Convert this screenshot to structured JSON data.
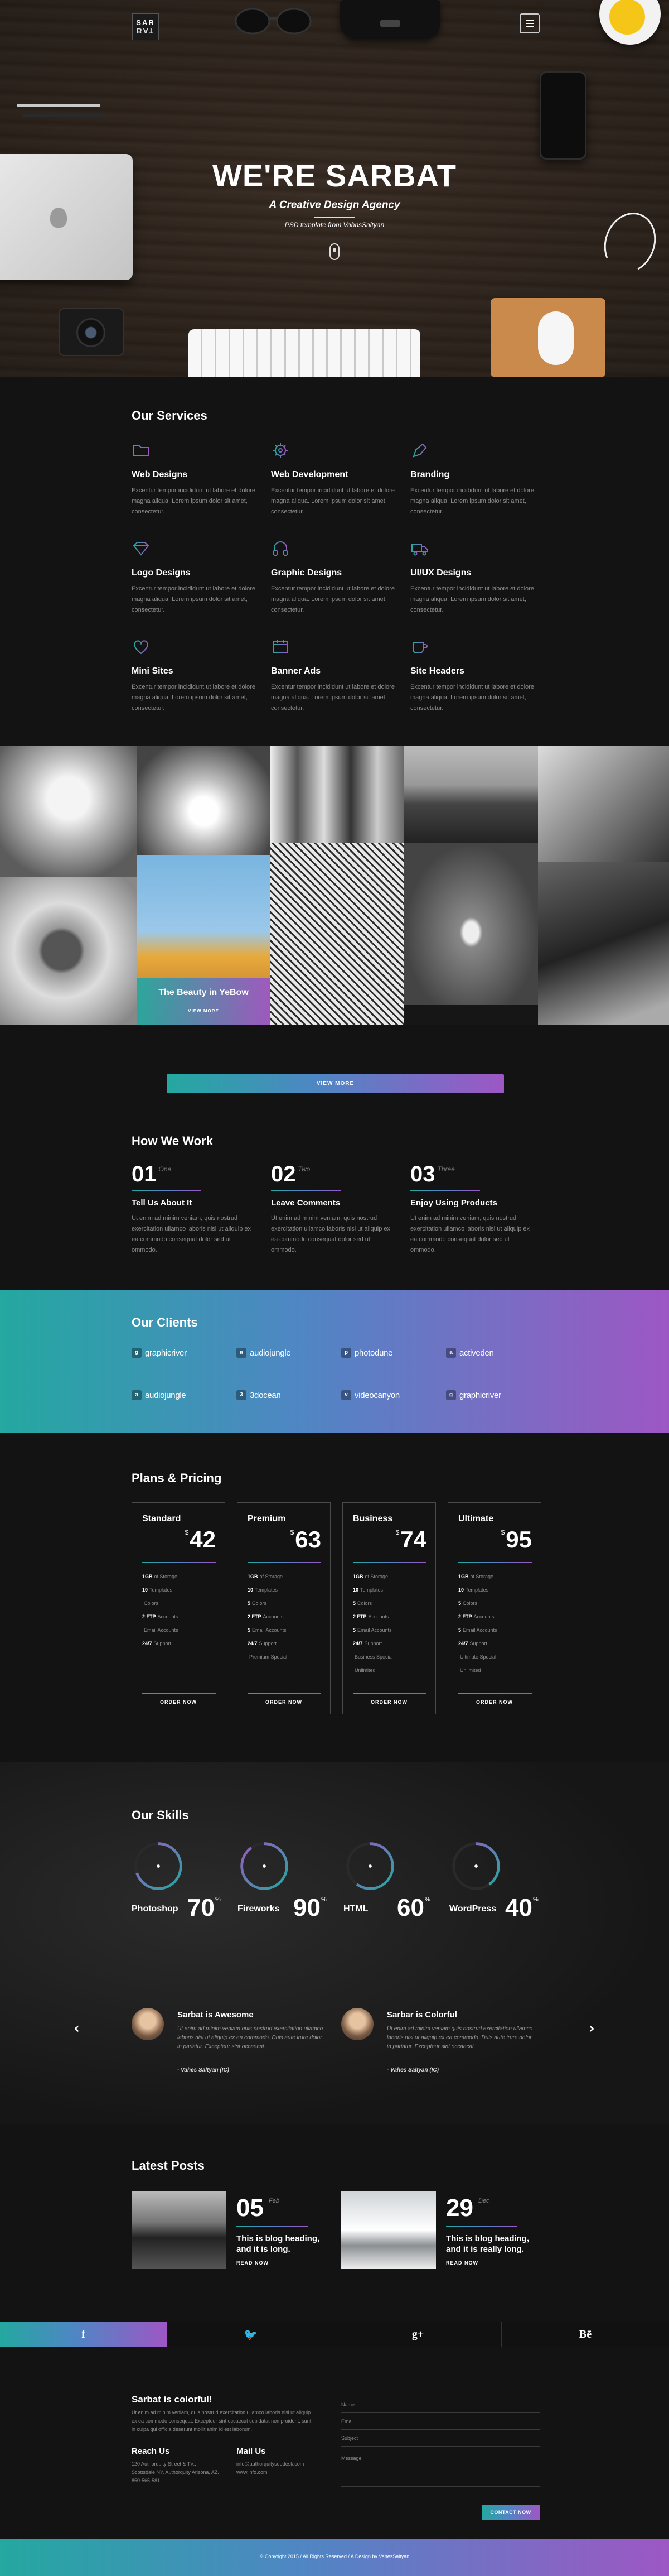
{
  "brand": {
    "logo_top": "SAR",
    "logo_bottom": "BAT"
  },
  "hero": {
    "title": "WE'RE SARBAT",
    "subtitle": "A Creative Design Agency",
    "credit": "PSD template from VahnsSaltyan"
  },
  "services": {
    "title": "Our Services",
    "items": [
      {
        "name": "Web Designs",
        "icon": "folder-icon",
        "desc": "Excentur tempor incididunt ut labore et dolore magna aliqua. Lorem ipsum dolor sit amet, consectetur."
      },
      {
        "name": "Web Development",
        "icon": "gear-icon",
        "desc": "Excentur tempor incididunt ut labore et dolore magna aliqua. Lorem ipsum dolor sit amet, consectetur."
      },
      {
        "name": "Branding",
        "icon": "pen-icon",
        "desc": "Excentur tempor incididunt ut labore et dolore magna aliqua. Lorem ipsum dolor sit amet, consectetur."
      },
      {
        "name": "Logo Designs",
        "icon": "diamond-icon",
        "desc": "Excentur tempor incididunt ut labore et dolore magna aliqua. Lorem ipsum dolor sit amet, consectetur."
      },
      {
        "name": "Graphic Designs",
        "icon": "headphones-icon",
        "desc": "Excentur tempor incididunt ut labore et dolore magna aliqua. Lorem ipsum dolor sit amet, consectetur."
      },
      {
        "name": "UI/UX Designs",
        "icon": "truck-icon",
        "desc": "Excentur tempor incididunt ut labore et dolore magna aliqua. Lorem ipsum dolor sit amet, consectetur."
      },
      {
        "name": "Mini Sites",
        "icon": "heart-icon",
        "desc": "Excentur tempor incididunt ut labore et dolore magna aliqua. Lorem ipsum dolor sit amet, consectetur."
      },
      {
        "name": "Banner Ads",
        "icon": "calendar-icon",
        "desc": "Excentur tempor incididunt ut labore et dolore magna aliqua. Lorem ipsum dolor sit amet, consectetur."
      },
      {
        "name": "Site Headers",
        "icon": "cup-icon",
        "desc": "Excentur tempor incididunt ut labore et dolore magna aliqua. Lorem ipsum dolor sit amet, consectetur."
      }
    ]
  },
  "gallery": {
    "caption": "The Beauty in YeBow",
    "caption_button": "VIEW MORE"
  },
  "view_more": "VIEW MORE",
  "how": {
    "title": "How We Work",
    "steps": [
      {
        "num": "01",
        "word": "One",
        "name": "Tell Us About It",
        "desc": "Ut enim ad minim veniam, quis nostrud exercitation ullamco laboris nisi ut aliquip ex ea commodo consequat dolor sed ut ommodo."
      },
      {
        "num": "02",
        "word": "Two",
        "name": "Leave Comments",
        "desc": "Ut enim ad minim veniam, quis nostrud exercitation ullamco laboris nisi ut aliquip ex ea commodo consequat dolor sed ut ommodo."
      },
      {
        "num": "03",
        "word": "Three",
        "name": "Enjoy Using Products",
        "desc": "Ut enim ad minim veniam, quis nostrud exercitation ullamco laboris nisi ut aliquip ex ea commodo consequat dolor sed ut ommodo."
      }
    ]
  },
  "clients": {
    "title": "Our Clients",
    "items": [
      {
        "name": "graphicriver",
        "glyph": "g"
      },
      {
        "name": "audiojungle",
        "glyph": "a"
      },
      {
        "name": "photodune",
        "glyph": "p"
      },
      {
        "name": "activeden",
        "glyph": "a"
      },
      {
        "name": "audiojungle",
        "glyph": "a"
      },
      {
        "name": "3docean",
        "glyph": "3"
      },
      {
        "name": "videocanyon",
        "glyph": "v"
      },
      {
        "name": "graphicriver",
        "glyph": "g"
      }
    ]
  },
  "pricing": {
    "title": "Plans & Pricing",
    "currency": "$",
    "order_label": "ORDER NOW",
    "plans": [
      {
        "name": "Standard",
        "price": "42",
        "features": [
          [
            "1GB",
            "of Storage"
          ],
          [
            "10",
            "Templates"
          ],
          [
            "",
            "Colors"
          ],
          [
            "2 FTP",
            "Accounts"
          ],
          [
            "",
            "Email Accounts"
          ],
          [
            "24/7",
            "Support"
          ]
        ]
      },
      {
        "name": "Premium",
        "price": "63",
        "features": [
          [
            "1GB",
            "of Storage"
          ],
          [
            "10",
            "Templates"
          ],
          [
            "5",
            "Colors"
          ],
          [
            "2 FTP",
            "Accounts"
          ],
          [
            "5",
            "Email Accounts"
          ],
          [
            "24/7",
            "Support"
          ],
          [
            "",
            "Premium Special"
          ]
        ]
      },
      {
        "name": "Business",
        "price": "74",
        "features": [
          [
            "1GB",
            "of Storage"
          ],
          [
            "10",
            "Templates"
          ],
          [
            "5",
            "Colors"
          ],
          [
            "2 FTP",
            "Accounts"
          ],
          [
            "5",
            "Email Accounts"
          ],
          [
            "24/7",
            "Support"
          ],
          [
            "",
            "Business Special"
          ],
          [
            "",
            "Unlimited"
          ]
        ]
      },
      {
        "name": "Ultimate",
        "price": "95",
        "features": [
          [
            "1GB",
            "of Storage"
          ],
          [
            "10",
            "Templates"
          ],
          [
            "5",
            "Colors"
          ],
          [
            "2 FTP",
            "Accounts"
          ],
          [
            "5",
            "Email Accounts"
          ],
          [
            "24/7",
            "Support"
          ],
          [
            "",
            "Ultimate Special"
          ],
          [
            "",
            "Unlimited"
          ]
        ]
      }
    ]
  },
  "skills": {
    "title": "Our Skills",
    "percent_sign": "%",
    "items": [
      {
        "name": "Photoshop",
        "value": "70",
        "fraction": 0.7
      },
      {
        "name": "Fireworks",
        "value": "90",
        "fraction": 0.9
      },
      {
        "name": "HTML",
        "value": "60",
        "fraction": 0.6
      },
      {
        "name": "WordPress",
        "value": "40",
        "fraction": 0.4
      }
    ],
    "colors": {
      "track": "#2a2a2a",
      "start": "#24a8a0",
      "end": "#9d57c4"
    }
  },
  "testimonials": [
    {
      "title": "Sarbat is Awesome",
      "quote": "Ut enim ad minim veniam quis nostrud exercitation ullamco laboris nisi ut aliquip ex ea commodo. Duis aute irure dolor in pariatur. Excepteur sint occaecat.",
      "author": "- Vahes Saltyan (IC)"
    },
    {
      "title": "Sarbar is Colorful",
      "quote": "Ut enim ad minim veniam quis nostrud exercitation ullamco laboris nisi ut aliquip ex ea commodo. Duis aute irure dolor in pariatur. Excepteur sint occaecat.",
      "author": "- Vahes Saltyan (IC)"
    }
  ],
  "posts": {
    "title": "Latest Posts",
    "read_more": "READ NOW",
    "items": [
      {
        "day": "05",
        "month": "Feb",
        "title": "This is blog heading, and it is long."
      },
      {
        "day": "29",
        "month": "Dec",
        "title": "This is blog heading, and it is really long."
      }
    ]
  },
  "social": [
    {
      "name": "facebook",
      "glyph": "f"
    },
    {
      "name": "twitter",
      "glyph": "🐦"
    },
    {
      "name": "google-plus",
      "glyph": "g+"
    },
    {
      "name": "behance",
      "glyph": "Bē"
    }
  ],
  "footer": {
    "title": "Sarbat is colorful!",
    "desc": "Ut enim ad minim veniam, quis nostrud exercitation ullamco laboris nisi ut aliquip ex ea commodo consequat. Excepteur sint occaecat cupidatat non proident, sunt in culpa qui officia deserunt mollit anim id est laborum.",
    "reach_title": "Reach Us",
    "reach_text": "120 Authorquity Street & TV., Scottsdale NY, Authorquity Arizona, AZ. 850-565-581",
    "mail_title": "Mail Us",
    "mail_text": "info@authorquitysuedesk.com www.info.com",
    "fields": [
      "Name",
      "Email",
      "Subject",
      "Message"
    ],
    "button": "CONTACT NOW",
    "copyright": "© Copyright 2015  /  All Rights Reserved  /  A Design by VahesSaltyan"
  },
  "accent": {
    "teal": "#24a8a0",
    "purple": "#9d57c4"
  }
}
